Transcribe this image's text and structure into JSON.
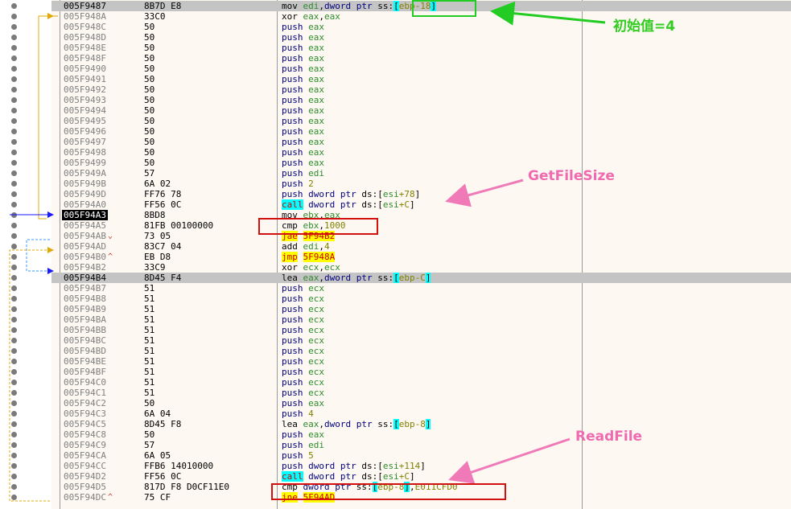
{
  "rows": [
    {
      "addr": "005F9487",
      "bytes": "8B7D E8",
      "asm": [
        [
          "mov ",
          "m"
        ],
        [
          "edi",
          "mg"
        ],
        [
          ",",
          "m"
        ],
        [
          "dword ptr ",
          "md"
        ],
        [
          "ss:",
          "m"
        ],
        [
          "[",
          "mbr"
        ],
        [
          "ebp-18",
          "mn"
        ],
        [
          "]",
          "mbr"
        ]
      ],
      "hl": true
    },
    {
      "addr": "005F948A",
      "bytes": "33C0",
      "asm": [
        [
          "xor ",
          "m"
        ],
        [
          "eax",
          "mg"
        ],
        [
          ",",
          "m"
        ],
        [
          "eax",
          "mg"
        ]
      ]
    },
    {
      "addr": "005F948C",
      "bytes": "50",
      "asm": [
        [
          "push ",
          "mb"
        ],
        [
          "eax",
          "mg"
        ]
      ]
    },
    {
      "addr": "005F948D",
      "bytes": "50",
      "asm": [
        [
          "push ",
          "mb"
        ],
        [
          "eax",
          "mg"
        ]
      ]
    },
    {
      "addr": "005F948E",
      "bytes": "50",
      "asm": [
        [
          "push ",
          "mb"
        ],
        [
          "eax",
          "mg"
        ]
      ]
    },
    {
      "addr": "005F948F",
      "bytes": "50",
      "asm": [
        [
          "push ",
          "mb"
        ],
        [
          "eax",
          "mg"
        ]
      ]
    },
    {
      "addr": "005F9490",
      "bytes": "50",
      "asm": [
        [
          "push ",
          "mb"
        ],
        [
          "eax",
          "mg"
        ]
      ]
    },
    {
      "addr": "005F9491",
      "bytes": "50",
      "asm": [
        [
          "push ",
          "mb"
        ],
        [
          "eax",
          "mg"
        ]
      ]
    },
    {
      "addr": "005F9492",
      "bytes": "50",
      "asm": [
        [
          "push ",
          "mb"
        ],
        [
          "eax",
          "mg"
        ]
      ]
    },
    {
      "addr": "005F9493",
      "bytes": "50",
      "asm": [
        [
          "push ",
          "mb"
        ],
        [
          "eax",
          "mg"
        ]
      ]
    },
    {
      "addr": "005F9494",
      "bytes": "50",
      "asm": [
        [
          "push ",
          "mb"
        ],
        [
          "eax",
          "mg"
        ]
      ]
    },
    {
      "addr": "005F9495",
      "bytes": "50",
      "asm": [
        [
          "push ",
          "mb"
        ],
        [
          "eax",
          "mg"
        ]
      ]
    },
    {
      "addr": "005F9496",
      "bytes": "50",
      "asm": [
        [
          "push ",
          "mb"
        ],
        [
          "eax",
          "mg"
        ]
      ]
    },
    {
      "addr": "005F9497",
      "bytes": "50",
      "asm": [
        [
          "push ",
          "mb"
        ],
        [
          "eax",
          "mg"
        ]
      ]
    },
    {
      "addr": "005F9498",
      "bytes": "50",
      "asm": [
        [
          "push ",
          "mb"
        ],
        [
          "eax",
          "mg"
        ]
      ]
    },
    {
      "addr": "005F9499",
      "bytes": "50",
      "asm": [
        [
          "push ",
          "mb"
        ],
        [
          "eax",
          "mg"
        ]
      ]
    },
    {
      "addr": "005F949A",
      "bytes": "57",
      "asm": [
        [
          "push ",
          "mb"
        ],
        [
          "edi",
          "mg"
        ]
      ]
    },
    {
      "addr": "005F949B",
      "bytes": "6A 02",
      "asm": [
        [
          "push ",
          "mb"
        ],
        [
          "2",
          "mn"
        ]
      ]
    },
    {
      "addr": "005F949D",
      "bytes": "FF76 78",
      "asm": [
        [
          "push ",
          "mb"
        ],
        [
          "dword ptr ",
          "md"
        ],
        [
          "ds:",
          "m"
        ],
        [
          "[",
          "m"
        ],
        [
          "esi",
          "mg"
        ],
        [
          "+78",
          "mn"
        ],
        [
          "]",
          "m"
        ]
      ]
    },
    {
      "addr": "005F94A0",
      "bytes": "FF56 0C",
      "asm": [
        [
          "call",
          "mc"
        ],
        [
          " dword ptr ",
          "md"
        ],
        [
          "ds:",
          "m"
        ],
        [
          "[",
          "m"
        ],
        [
          "esi",
          "mg"
        ],
        [
          "+C",
          "mn"
        ],
        [
          "]",
          "m"
        ]
      ]
    },
    {
      "addr": "005F94A3",
      "bytes": "8BD8",
      "asm": [
        [
          "mov ",
          "m"
        ],
        [
          "ebx",
          "mg"
        ],
        [
          ",",
          "m"
        ],
        [
          "eax",
          "mg"
        ]
      ],
      "sel": true
    },
    {
      "addr": "005F94A5",
      "bytes": "81FB 00100000",
      "asm": [
        [
          "cmp ",
          "m"
        ],
        [
          "ebx",
          "mg"
        ],
        [
          ",",
          "m"
        ],
        [
          "1000",
          "mn"
        ]
      ]
    },
    {
      "addr": "005F94AB",
      "bytes": "73 05",
      "jm": "⌄",
      "asm": [
        [
          "jae",
          "mj"
        ],
        [
          " ",
          "m"
        ],
        [
          "5F94B2",
          "mj"
        ]
      ]
    },
    {
      "addr": "005F94AD",
      "bytes": "83C7 04",
      "asm": [
        [
          "add ",
          "m"
        ],
        [
          "edi",
          "mg"
        ],
        [
          ",",
          "m"
        ],
        [
          "4",
          "mn"
        ]
      ]
    },
    {
      "addr": "005F94B0",
      "bytes": "EB D8",
      "jm": "^",
      "asm": [
        [
          "jmp",
          "mj"
        ],
        [
          " ",
          "m"
        ],
        [
          "5F948A",
          "mj"
        ]
      ]
    },
    {
      "addr": "005F94B2",
      "bytes": "33C9",
      "asm": [
        [
          "xor ",
          "m"
        ],
        [
          "ecx",
          "mg"
        ],
        [
          ",",
          "m"
        ],
        [
          "ecx",
          "mg"
        ]
      ]
    },
    {
      "addr": "005F94B4",
      "bytes": "8D45 F4",
      "asm": [
        [
          "lea ",
          "m"
        ],
        [
          "eax",
          "mg"
        ],
        [
          ",",
          "m"
        ],
        [
          "dword ptr ",
          "md"
        ],
        [
          "ss:",
          "m"
        ],
        [
          "[",
          "mbr"
        ],
        [
          "ebp-C",
          "mn"
        ],
        [
          "]",
          "mbr"
        ]
      ],
      "hl": true
    },
    {
      "addr": "005F94B7",
      "bytes": "51",
      "asm": [
        [
          "push ",
          "mb"
        ],
        [
          "ecx",
          "mg"
        ]
      ]
    },
    {
      "addr": "005F94B8",
      "bytes": "51",
      "asm": [
        [
          "push ",
          "mb"
        ],
        [
          "ecx",
          "mg"
        ]
      ]
    },
    {
      "addr": "005F94B9",
      "bytes": "51",
      "asm": [
        [
          "push ",
          "mb"
        ],
        [
          "ecx",
          "mg"
        ]
      ]
    },
    {
      "addr": "005F94BA",
      "bytes": "51",
      "asm": [
        [
          "push ",
          "mb"
        ],
        [
          "ecx",
          "mg"
        ]
      ]
    },
    {
      "addr": "005F94BB",
      "bytes": "51",
      "asm": [
        [
          "push ",
          "mb"
        ],
        [
          "ecx",
          "mg"
        ]
      ]
    },
    {
      "addr": "005F94BC",
      "bytes": "51",
      "asm": [
        [
          "push ",
          "mb"
        ],
        [
          "ecx",
          "mg"
        ]
      ]
    },
    {
      "addr": "005F94BD",
      "bytes": "51",
      "asm": [
        [
          "push ",
          "mb"
        ],
        [
          "ecx",
          "mg"
        ]
      ]
    },
    {
      "addr": "005F94BE",
      "bytes": "51",
      "asm": [
        [
          "push ",
          "mb"
        ],
        [
          "ecx",
          "mg"
        ]
      ]
    },
    {
      "addr": "005F94BF",
      "bytes": "51",
      "asm": [
        [
          "push ",
          "mb"
        ],
        [
          "ecx",
          "mg"
        ]
      ]
    },
    {
      "addr": "005F94C0",
      "bytes": "51",
      "asm": [
        [
          "push ",
          "mb"
        ],
        [
          "ecx",
          "mg"
        ]
      ]
    },
    {
      "addr": "005F94C1",
      "bytes": "51",
      "asm": [
        [
          "push ",
          "mb"
        ],
        [
          "ecx",
          "mg"
        ]
      ]
    },
    {
      "addr": "005F94C2",
      "bytes": "50",
      "asm": [
        [
          "push ",
          "mb"
        ],
        [
          "eax",
          "mg"
        ]
      ]
    },
    {
      "addr": "005F94C3",
      "bytes": "6A 04",
      "asm": [
        [
          "push ",
          "mb"
        ],
        [
          "4",
          "mn"
        ]
      ]
    },
    {
      "addr": "005F94C5",
      "bytes": "8D45 F8",
      "asm": [
        [
          "lea ",
          "m"
        ],
        [
          "eax",
          "mg"
        ],
        [
          ",",
          "m"
        ],
        [
          "dword ptr ",
          "md"
        ],
        [
          "ss:",
          "m"
        ],
        [
          "[",
          "mbr"
        ],
        [
          "ebp-8",
          "mn"
        ],
        [
          "]",
          "mbr"
        ]
      ]
    },
    {
      "addr": "005F94C8",
      "bytes": "50",
      "asm": [
        [
          "push ",
          "mb"
        ],
        [
          "eax",
          "mg"
        ]
      ]
    },
    {
      "addr": "005F94C9",
      "bytes": "57",
      "asm": [
        [
          "push ",
          "mb"
        ],
        [
          "edi",
          "mg"
        ]
      ]
    },
    {
      "addr": "005F94CA",
      "bytes": "6A 05",
      "asm": [
        [
          "push ",
          "mb"
        ],
        [
          "5",
          "mn"
        ]
      ]
    },
    {
      "addr": "005F94CC",
      "bytes": "FFB6 14010000",
      "asm": [
        [
          "push ",
          "mb"
        ],
        [
          "dword ptr ",
          "md"
        ],
        [
          "ds:",
          "m"
        ],
        [
          "[",
          "m"
        ],
        [
          "esi",
          "mg"
        ],
        [
          "+114",
          "mn"
        ],
        [
          "]",
          "m"
        ]
      ]
    },
    {
      "addr": "005F94D2",
      "bytes": "FF56 0C",
      "asm": [
        [
          "call",
          "mc"
        ],
        [
          " dword ptr ",
          "md"
        ],
        [
          "ds:",
          "m"
        ],
        [
          "[",
          "m"
        ],
        [
          "esi",
          "mg"
        ],
        [
          "+C",
          "mn"
        ],
        [
          "]",
          "m"
        ]
      ]
    },
    {
      "addr": "005F94D5",
      "bytes": "817D F8 D0CF11E0",
      "asm": [
        [
          "cmp ",
          "m"
        ],
        [
          "dword ptr ",
          "md"
        ],
        [
          "ss:",
          "m"
        ],
        [
          "[",
          "mbr"
        ],
        [
          "ebp-8",
          "mn"
        ],
        [
          "]",
          "mbr"
        ],
        [
          ",",
          "m"
        ],
        [
          "E011CFD0",
          "mn"
        ]
      ]
    },
    {
      "addr": "005F94DC",
      "bytes": "75 CF",
      "jm": "^",
      "asm": [
        [
          "jne",
          "mj"
        ],
        [
          " ",
          "m"
        ],
        [
          "5F94AD",
          "mj"
        ]
      ]
    }
  ],
  "annotations": {
    "init_value": "初始值=4",
    "get_file_size": "GetFileSize",
    "read_file": "ReadFile"
  },
  "colors": {
    "box_green": "#22cc22",
    "box_red": "#d21010",
    "arrow_pink": "#f07ab8",
    "label_green": "#33cc22",
    "label_pink": "#f06ab0"
  }
}
